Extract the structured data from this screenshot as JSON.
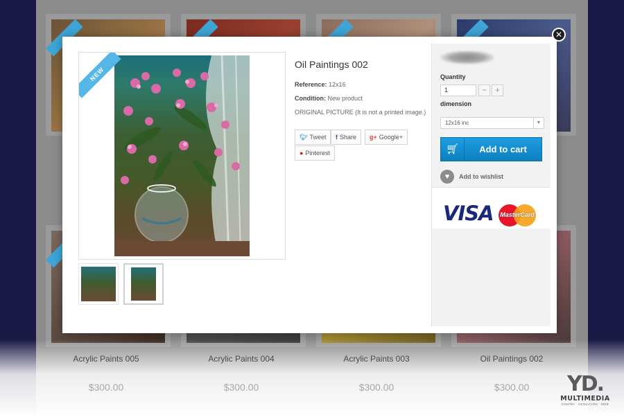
{
  "background": {
    "products": [
      {
        "name": "Acrylic Paints 005",
        "price": "$300.00"
      },
      {
        "name": "Acrylic Paints 004",
        "price": "$300.00"
      },
      {
        "name": "Acrylic Paints 003",
        "price": "$300.00"
      },
      {
        "name": "Oil Paintings 002",
        "price": "$300.00"
      }
    ]
  },
  "modal": {
    "close_icon": "close-icon",
    "badge": "NEW",
    "title": "Oil Paintings 002",
    "reference_label": "Reference:",
    "reference_value": "12x16",
    "condition_label": "Condition:",
    "condition_value": "New product",
    "description": "ORIGINAL PICTURE (It is not a printed image.)",
    "social": {
      "tweet": "Tweet",
      "share": "Share",
      "google": "Google+",
      "pinterest": "Pinterest"
    },
    "quantity_label": "Quantity",
    "quantity_value": "1",
    "dimension_label": "dimension",
    "dimension_value": "12x16 inc",
    "add_to_cart": "Add to cart",
    "wishlist": "Add to wishlist",
    "accent_color": "#1a8fd4"
  },
  "watermark": {
    "mark": "YD.",
    "brand": "MULTIMEDIA",
    "sub": "DISEÑO · ANIMACIÓN · WEB"
  }
}
